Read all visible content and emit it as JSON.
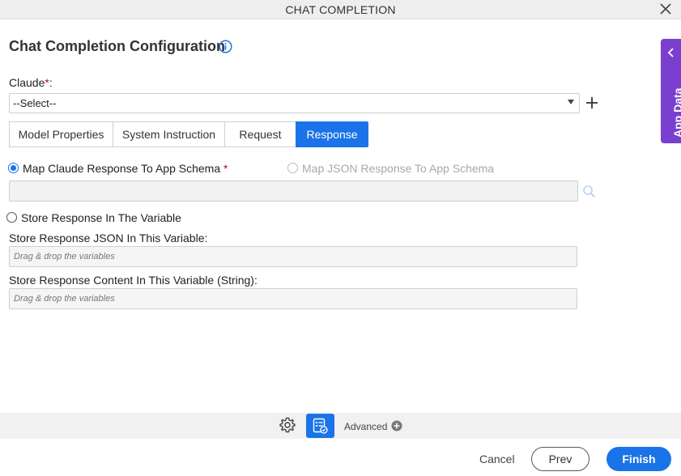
{
  "window": {
    "title": "CHAT COMPLETION"
  },
  "header": {
    "title": "Chat Completion Configuration"
  },
  "claude": {
    "label": "Claude",
    "required_mark": "*",
    "colon": ":",
    "selected": "--Select--"
  },
  "tabs": [
    {
      "label": "Model Properties"
    },
    {
      "label": "System Instruction"
    },
    {
      "label": "Request"
    },
    {
      "label": "Response"
    }
  ],
  "options": {
    "map_claude": {
      "label": "Map Claude Response To App Schema",
      "required_mark": "*"
    },
    "map_json": {
      "label": "Map JSON Response To App Schema"
    },
    "store_var": {
      "label": "Store Response In The Variable"
    }
  },
  "fields": {
    "store_json": {
      "label": "Store Response JSON In This Variable:",
      "placeholder": "Drag & drop the variables"
    },
    "store_content": {
      "label": "Store Response Content In This Variable (String):",
      "placeholder": "Drag & drop the variables"
    }
  },
  "toolbar": {
    "advanced": "Advanced"
  },
  "footer": {
    "cancel": "Cancel",
    "prev": "Prev",
    "finish": "Finish"
  },
  "side_panel": {
    "label": "App Data"
  },
  "colors": {
    "accent": "#1a73e8",
    "side_panel": "#7b3fd0",
    "required": "#d0021b"
  }
}
